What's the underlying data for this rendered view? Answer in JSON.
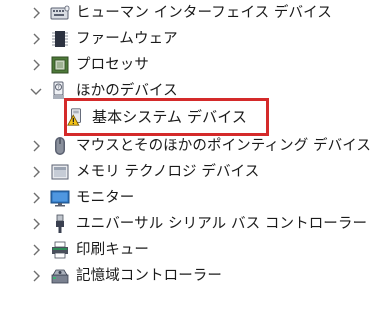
{
  "tree": {
    "items": [
      {
        "label": "ヒューマン インターフェイス デバイス",
        "icon": "hid-device-icon",
        "expanded": false
      },
      {
        "label": "ファームウェア",
        "icon": "firmware-chip-icon",
        "expanded": false
      },
      {
        "label": "プロセッサ",
        "icon": "processor-icon",
        "expanded": false
      },
      {
        "label": "ほかのデバイス",
        "icon": "other-devices-icon",
        "expanded": true
      },
      {
        "label": "基本システム デバイス",
        "icon": "warning-device-icon",
        "child": true
      },
      {
        "label": "マウスとそのほかのポインティング デバイス",
        "icon": "mouse-icon",
        "expanded": false
      },
      {
        "label": "メモリ テクノロジ デバイス",
        "icon": "memory-technology-icon",
        "expanded": false
      },
      {
        "label": "モニター",
        "icon": "monitor-icon",
        "expanded": false
      },
      {
        "label": "ユニバーサル シリアル バス コントローラー",
        "icon": "usb-icon",
        "expanded": false
      },
      {
        "label": "印刷キュー",
        "icon": "printer-icon",
        "expanded": false
      },
      {
        "label": "記憶域コントローラー",
        "icon": "storage-controller-icon",
        "expanded": false
      }
    ]
  },
  "colors": {
    "highlight_border": "#d42a2a",
    "chevron": "#6e6e6e",
    "text": "#1a1a1a"
  }
}
